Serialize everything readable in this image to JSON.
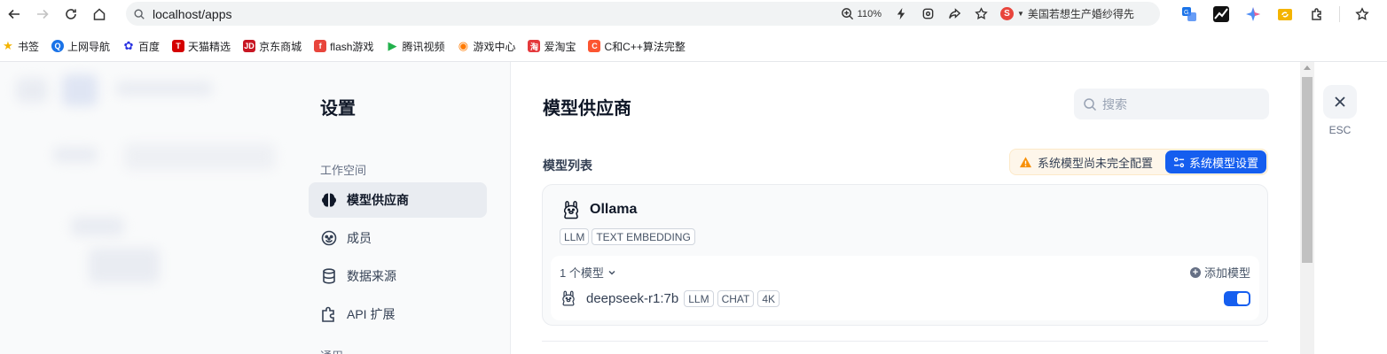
{
  "browser": {
    "url": "localhost/apps",
    "zoom": "110%",
    "search_engine_text": "美国若想生产婚纱得先",
    "bookmarks": [
      {
        "label": "书签",
        "icon": "star-icon",
        "color": "#f4b400"
      },
      {
        "label": "上网导航",
        "icon": "navigation-icon",
        "color": "#1a73e8"
      },
      {
        "label": "百度",
        "icon": "baidu-icon",
        "color": "#2932e1"
      },
      {
        "label": "天猫精选",
        "icon": "tmall-icon",
        "color": "#d40000"
      },
      {
        "label": "京东商城",
        "icon": "jd-icon",
        "color": "#c81623"
      },
      {
        "label": "flash游戏",
        "icon": "flash-icon",
        "color": "#e8453c"
      },
      {
        "label": "腾讯视频",
        "icon": "tencent-video-icon",
        "color": "#22b14c"
      },
      {
        "label": "游戏中心",
        "icon": "game-icon",
        "color": "#ff7a00"
      },
      {
        "label": "爱淘宝",
        "icon": "taobao-icon",
        "color": "#e4393c"
      },
      {
        "label": "C和C++算法完整",
        "icon": "csdn-icon",
        "color": "#fc5531"
      }
    ]
  },
  "settings": {
    "title": "设置",
    "section_workspace": "工作空间",
    "nav_items": [
      {
        "label": "模型供应商",
        "icon": "brain-icon",
        "active": true
      },
      {
        "label": "成员",
        "icon": "members-icon",
        "active": false
      },
      {
        "label": "数据来源",
        "icon": "database-icon",
        "active": false
      },
      {
        "label": "API 扩展",
        "icon": "puzzle-icon",
        "active": false
      }
    ],
    "section_general": "通用"
  },
  "main": {
    "title": "模型供应商",
    "search_placeholder": "搜索",
    "list_label": "模型列表",
    "warning_text": "系统模型尚未完全配置",
    "system_model_button": "系统模型设置",
    "provider": {
      "name": "Ollama",
      "icon": "llama-icon",
      "tags": [
        "LLM",
        "TEXT EMBEDDING"
      ],
      "model_count": "1 个模型",
      "add_model_label": "添加模型",
      "models": [
        {
          "name": "deepseek-r1:7b",
          "tags": [
            "LLM",
            "CHAT",
            "4K"
          ],
          "enabled": true
        }
      ]
    }
  },
  "close": {
    "esc_label": "ESC"
  },
  "colors": {
    "accent": "#155eef",
    "warning": "#f79009"
  }
}
